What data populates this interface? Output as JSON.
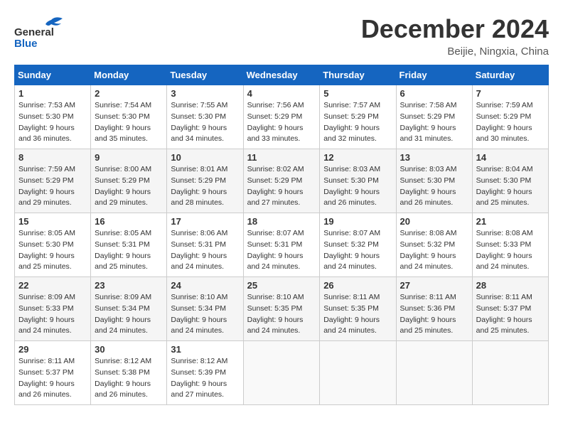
{
  "header": {
    "logo_line1": "General",
    "logo_line2": "Blue",
    "month_title": "December 2024",
    "location": "Beijie, Ningxia, China"
  },
  "weekdays": [
    "Sunday",
    "Monday",
    "Tuesday",
    "Wednesday",
    "Thursday",
    "Friday",
    "Saturday"
  ],
  "weeks": [
    [
      {
        "day": "1",
        "sunrise": "7:53 AM",
        "sunset": "5:30 PM",
        "daylight": "9 hours and 36 minutes."
      },
      {
        "day": "2",
        "sunrise": "7:54 AM",
        "sunset": "5:30 PM",
        "daylight": "9 hours and 35 minutes."
      },
      {
        "day": "3",
        "sunrise": "7:55 AM",
        "sunset": "5:30 PM",
        "daylight": "9 hours and 34 minutes."
      },
      {
        "day": "4",
        "sunrise": "7:56 AM",
        "sunset": "5:29 PM",
        "daylight": "9 hours and 33 minutes."
      },
      {
        "day": "5",
        "sunrise": "7:57 AM",
        "sunset": "5:29 PM",
        "daylight": "9 hours and 32 minutes."
      },
      {
        "day": "6",
        "sunrise": "7:58 AM",
        "sunset": "5:29 PM",
        "daylight": "9 hours and 31 minutes."
      },
      {
        "day": "7",
        "sunrise": "7:59 AM",
        "sunset": "5:29 PM",
        "daylight": "9 hours and 30 minutes."
      }
    ],
    [
      {
        "day": "8",
        "sunrise": "7:59 AM",
        "sunset": "5:29 PM",
        "daylight": "9 hours and 29 minutes."
      },
      {
        "day": "9",
        "sunrise": "8:00 AM",
        "sunset": "5:29 PM",
        "daylight": "9 hours and 29 minutes."
      },
      {
        "day": "10",
        "sunrise": "8:01 AM",
        "sunset": "5:29 PM",
        "daylight": "9 hours and 28 minutes."
      },
      {
        "day": "11",
        "sunrise": "8:02 AM",
        "sunset": "5:29 PM",
        "daylight": "9 hours and 27 minutes."
      },
      {
        "day": "12",
        "sunrise": "8:03 AM",
        "sunset": "5:30 PM",
        "daylight": "9 hours and 26 minutes."
      },
      {
        "day": "13",
        "sunrise": "8:03 AM",
        "sunset": "5:30 PM",
        "daylight": "9 hours and 26 minutes."
      },
      {
        "day": "14",
        "sunrise": "8:04 AM",
        "sunset": "5:30 PM",
        "daylight": "9 hours and 25 minutes."
      }
    ],
    [
      {
        "day": "15",
        "sunrise": "8:05 AM",
        "sunset": "5:30 PM",
        "daylight": "9 hours and 25 minutes."
      },
      {
        "day": "16",
        "sunrise": "8:05 AM",
        "sunset": "5:31 PM",
        "daylight": "9 hours and 25 minutes."
      },
      {
        "day": "17",
        "sunrise": "8:06 AM",
        "sunset": "5:31 PM",
        "daylight": "9 hours and 24 minutes."
      },
      {
        "day": "18",
        "sunrise": "8:07 AM",
        "sunset": "5:31 PM",
        "daylight": "9 hours and 24 minutes."
      },
      {
        "day": "19",
        "sunrise": "8:07 AM",
        "sunset": "5:32 PM",
        "daylight": "9 hours and 24 minutes."
      },
      {
        "day": "20",
        "sunrise": "8:08 AM",
        "sunset": "5:32 PM",
        "daylight": "9 hours and 24 minutes."
      },
      {
        "day": "21",
        "sunrise": "8:08 AM",
        "sunset": "5:33 PM",
        "daylight": "9 hours and 24 minutes."
      }
    ],
    [
      {
        "day": "22",
        "sunrise": "8:09 AM",
        "sunset": "5:33 PM",
        "daylight": "9 hours and 24 minutes."
      },
      {
        "day": "23",
        "sunrise": "8:09 AM",
        "sunset": "5:34 PM",
        "daylight": "9 hours and 24 minutes."
      },
      {
        "day": "24",
        "sunrise": "8:10 AM",
        "sunset": "5:34 PM",
        "daylight": "9 hours and 24 minutes."
      },
      {
        "day": "25",
        "sunrise": "8:10 AM",
        "sunset": "5:35 PM",
        "daylight": "9 hours and 24 minutes."
      },
      {
        "day": "26",
        "sunrise": "8:11 AM",
        "sunset": "5:35 PM",
        "daylight": "9 hours and 24 minutes."
      },
      {
        "day": "27",
        "sunrise": "8:11 AM",
        "sunset": "5:36 PM",
        "daylight": "9 hours and 25 minutes."
      },
      {
        "day": "28",
        "sunrise": "8:11 AM",
        "sunset": "5:37 PM",
        "daylight": "9 hours and 25 minutes."
      }
    ],
    [
      {
        "day": "29",
        "sunrise": "8:11 AM",
        "sunset": "5:37 PM",
        "daylight": "9 hours and 26 minutes."
      },
      {
        "day": "30",
        "sunrise": "8:12 AM",
        "sunset": "5:38 PM",
        "daylight": "9 hours and 26 minutes."
      },
      {
        "day": "31",
        "sunrise": "8:12 AM",
        "sunset": "5:39 PM",
        "daylight": "9 hours and 27 minutes."
      },
      null,
      null,
      null,
      null
    ]
  ]
}
